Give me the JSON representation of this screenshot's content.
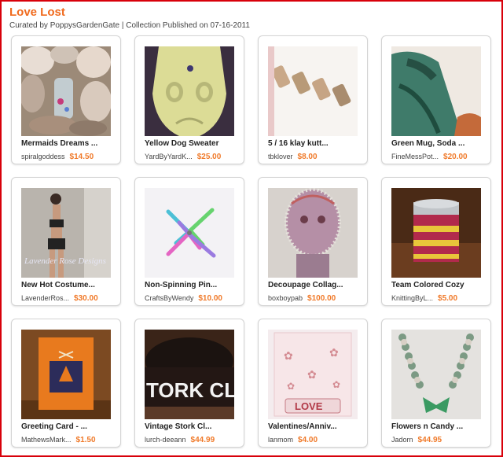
{
  "page": {
    "title": "Love Lost",
    "subtitle": "Curated by PoppysGardenGate | Collection Published on 07-16-2011"
  },
  "colors": {
    "title": "#f06a1d",
    "price": "#f07a2a",
    "border": "#d8000a"
  },
  "items": [
    {
      "name": "Mermaids Dreams ...",
      "shop": "spiralgoddess",
      "price": "$14.50"
    },
    {
      "name": "Yellow Dog Sweater",
      "shop": "YardByYardK...",
      "price": "$25.00"
    },
    {
      "name": "5 / 16 klay kutt...",
      "shop": "tbklover",
      "price": "$8.00"
    },
    {
      "name": "Green Mug, Soda ...",
      "shop": "FineMessPot...",
      "price": "$20.00"
    },
    {
      "name": "New Hot Costume...",
      "shop": "LavenderRos...",
      "price": "$30.00"
    },
    {
      "name": "Non-Spinning Pin...",
      "shop": "CraftsByWendy",
      "price": "$10.00"
    },
    {
      "name": "Decoupage Collag...",
      "shop": "boxboypab",
      "price": "$100.00"
    },
    {
      "name": "Team Colored Cozy",
      "shop": "KnittingByL...",
      "price": "$5.00"
    },
    {
      "name": "Greeting Card - ...",
      "shop": "MathewsMark...",
      "price": "$1.50"
    },
    {
      "name": "Vintage Stork Cl...",
      "shop": "lurch-deeann",
      "price": "$44.99"
    },
    {
      "name": "Valentines/Anniv...",
      "shop": "lanmom",
      "price": "$4.00"
    },
    {
      "name": "Flowers n Candy ...",
      "shop": "Jadorn",
      "price": "$44.95"
    }
  ],
  "image_text": {
    "lavender_watermark": "Lavender Rose Designs",
    "stork_text": "TORK CLU",
    "valentine_text": "LOVE"
  }
}
